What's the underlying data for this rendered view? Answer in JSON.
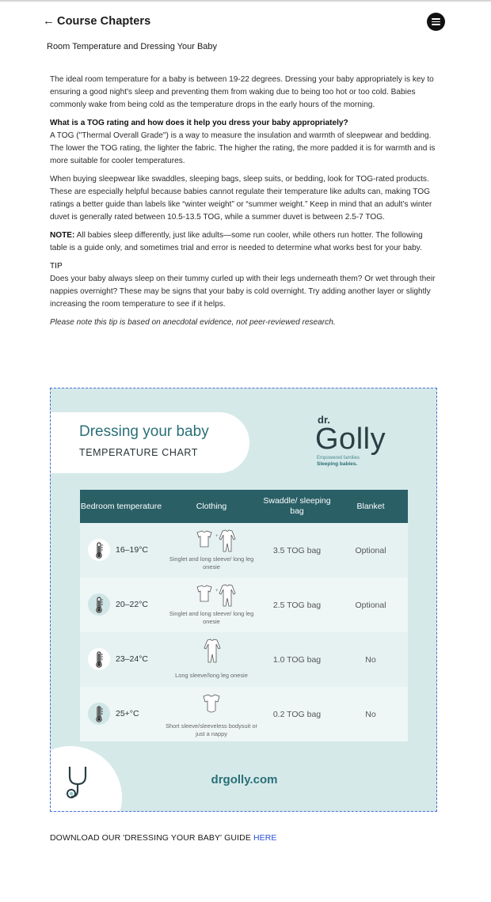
{
  "header": {
    "back_label": "Course Chapters",
    "back_icon": "arrow-left-icon",
    "menu_icon": "menu-icon"
  },
  "lesson": {
    "title": "Room Temperature and Dressing Your Baby"
  },
  "article": {
    "p1": "The ideal room temperature for a baby is between 19-22 degrees. Dressing your baby appropriately is key to ensuring a good night's sleep and preventing them from waking due to being too hot or too cold. Babies commonly wake from being cold as the temperature drops in the early hours of the morning.",
    "tog_heading": "What is a TOG rating and how does it help you dress your baby appropriately?",
    "p2": "A TOG (\"Thermal Overall Grade\") is a way to measure the insulation and warmth of sleepwear and bedding. The lower the TOG rating, the lighter the fabric. The higher the rating, the more padded it is for warmth and is more suitable for cooler temperatures.",
    "p3": "When buying sleepwear like swaddles, sleeping bags, sleep suits, or bedding, look for TOG-rated products. These are especially helpful because babies cannot regulate their temperature like adults can, making TOG ratings a better guide than labels like “winter weight” or “summer weight.” Keep in mind that an adult’s winter duvet is generally rated between 10.5-13.5 TOG, while a summer duvet is between 2.5-7 TOG.",
    "note_label": "NOTE:",
    "note_text": " All babies sleep differently, just like adults—some run cooler, while others run hotter. The following table is a guide only, and sometimes trial and error is needed to determine what works best for your baby.",
    "tip_heading": "TIP",
    "tip_text": "Does your baby always sleep on their tummy curled up with their legs underneath them? Or wet through their nappies overnight? These may be signs that your baby is cold overnight. Try adding another layer or slightly increasing the room temperature to see if it helps.",
    "disclaimer": "Please note this tip is based on anecdotal evidence, not peer-reviewed research."
  },
  "chart_image": {
    "title": "Dressing your baby",
    "subtitle": "TEMPERATURE CHART",
    "logo_dr": "dr.",
    "logo_name": "Golly",
    "logo_tagline1": "Empowered families",
    "logo_tagline2": "Sleeping babies.",
    "columns": [
      "Bedroom temperature",
      "Clothing",
      "Swaddle/ sleeping bag",
      "Blanket"
    ],
    "rows": [
      {
        "temp": "16–19°C",
        "clothing": "Singlet and long sleeve/ long leg onesie",
        "bag": "3.5 TOG bag",
        "blanket": "Optional"
      },
      {
        "temp": "20–22°C",
        "clothing": "Singlet and long sleeve/ long leg onesie",
        "bag": "2.5 TOG bag",
        "blanket": "Optional"
      },
      {
        "temp": "23–24°C",
        "clothing": "Long sleeve/long leg onesie",
        "bag": "1.0 TOG bag",
        "blanket": "No"
      },
      {
        "temp": "25+°C",
        "clothing": "Short sleeve/sleeveless bodysuit or just a nappy",
        "bag": "0.2 TOG bag",
        "blanket": "No"
      }
    ],
    "website": "drgolly.com",
    "colors": {
      "teal": "#2a6f77",
      "header": "#2a5f66",
      "background": "#d6e9e9"
    }
  },
  "download": {
    "text": "DOWNLOAD OUR 'DRESSING YOUR BABY' GUIDE ",
    "link_label": "HERE",
    "link_color": "#2a4fd8"
  }
}
